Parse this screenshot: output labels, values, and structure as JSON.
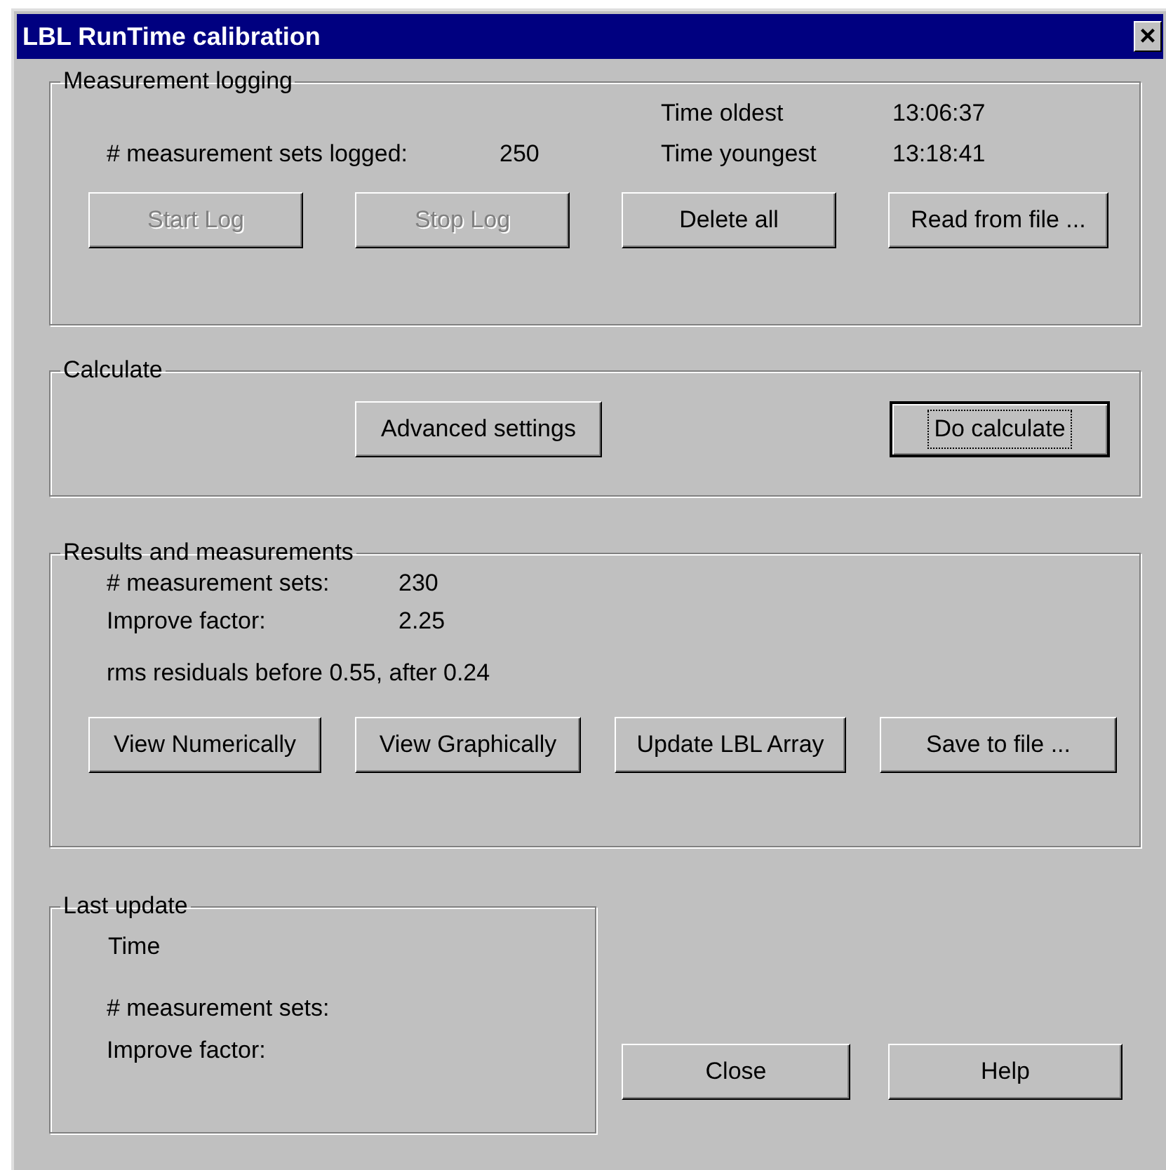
{
  "window": {
    "title": "LBL RunTime calibration",
    "close_glyph": "×"
  },
  "measurement_logging": {
    "title": "Measurement logging",
    "sets_logged_label": "# measurement sets logged:",
    "sets_logged_value": "250",
    "time_oldest_label": "Time oldest",
    "time_oldest": "13:06:37",
    "time_youngest_label": "Time youngest",
    "time_youngest": "13:18:41",
    "buttons": [
      {
        "label": "Start Log",
        "disabled": true
      },
      {
        "label": "Stop Log",
        "disabled": true
      },
      {
        "label": "Delete all",
        "disabled": false
      },
      {
        "label": "Read from file ...",
        "disabled": false
      }
    ]
  },
  "calculate": {
    "title": "Calculate",
    "buttons": [
      {
        "label": "Advanced settings",
        "focused": false
      },
      {
        "label": "Do calculate",
        "focused": true
      }
    ]
  },
  "results": {
    "title": "Results and measurements",
    "sets_label": "# measurement sets:",
    "sets_value": "230",
    "improve_label": "Improve factor:",
    "improve_value": "2.25",
    "rms": "rms residuals before 0.55, after 0.24",
    "buttons": [
      {
        "label": "View Numerically"
      },
      {
        "label": "View Graphically"
      },
      {
        "label": "Update LBL Array"
      },
      {
        "label": "Save to file ..."
      }
    ]
  },
  "last_update": {
    "title": "Last update",
    "time_label": "Time",
    "sets_label": "# measurement sets:",
    "improve_label": "Improve factor:"
  },
  "buttons": [
    {
      "label": "Close"
    },
    {
      "label": "Help"
    }
  ]
}
